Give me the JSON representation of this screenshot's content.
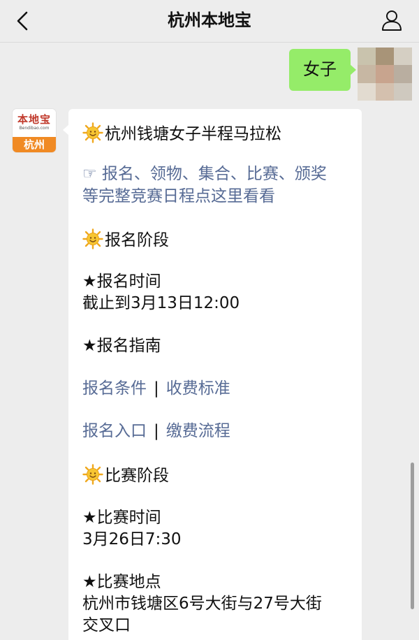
{
  "header": {
    "back_icon": "chevron-left-icon",
    "title": "杭州本地宝",
    "profile_icon": "person-icon"
  },
  "outgoing": {
    "text": "女子",
    "bubble_color": "#95ec69",
    "avatar_pixel_colors": [
      "#c9c3ad",
      "#a89478",
      "#d5cfc3",
      "#c7b7a3",
      "#c8a48e",
      "#b9aea0",
      "#e2dbd0",
      "#d4c0ae",
      "#cfc9bf"
    ]
  },
  "account_avatar": {
    "logo_text": "本地宝",
    "logo_subtext": "Bendibao.com",
    "city": "杭州",
    "accent_color": "#f08a24"
  },
  "message": {
    "title": "杭州钱塘女子半程马拉松",
    "schedule_link_line1": "☞ 报名、领物、集合、比赛、颁奖",
    "schedule_link_line2": "等完整竞赛日程点这里看看",
    "section_signup": "报名阶段",
    "signup_time_label": "★报名时间",
    "signup_time_value": "截止到3月13日12:00",
    "signup_guide_label": "★报名指南",
    "link_conditions": "报名条件",
    "link_fees": "收费标准",
    "link_entry": "报名入口",
    "link_payment": "缴费流程",
    "link_separator": "|",
    "section_race": "比赛阶段",
    "race_time_label": "★比赛时间",
    "race_time_value": "3月26日7:30",
    "race_place_label": "★比赛地点",
    "race_place_value_line1": "杭州市钱塘区6号大街与27号大街",
    "race_place_value_line2": "交叉口",
    "link_color": "#576b95",
    "emoji_icon": "sun-emoji-icon"
  }
}
